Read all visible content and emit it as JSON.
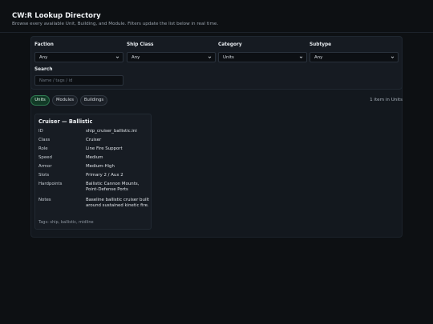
{
  "header": {
    "title": "CW:R Lookup Directory",
    "subtitle": "Browse every available Unit, Building, and Module. Filters update the list below in real time."
  },
  "filters": {
    "faction": {
      "label": "Faction",
      "value": "Any"
    },
    "ship_class": {
      "label": "Ship Class",
      "value": "Any"
    },
    "category": {
      "label": "Category",
      "value": "Units"
    },
    "subtype": {
      "label": "Subtype",
      "value": "Any"
    },
    "search": {
      "label": "Search",
      "placeholder": "Name / tags / id"
    }
  },
  "tabs": [
    {
      "label": "Units",
      "active": true
    },
    {
      "label": "Modules",
      "active": false
    },
    {
      "label": "Buildings",
      "active": false
    }
  ],
  "result_count": "1 item in Units",
  "card": {
    "title": "Cruiser — Ballistic",
    "rows": [
      {
        "key": "ID",
        "value": "ship_cruiser_ballistic.ini"
      },
      {
        "key": "Class",
        "value": "Cruiser"
      },
      {
        "key": "Role",
        "value": "Line Fire Support"
      },
      {
        "key": "Speed",
        "value": "Medium"
      },
      {
        "key": "Armor",
        "value": "Medium-High"
      },
      {
        "key": "Slots",
        "value": "Primary 2 / Aux 2"
      },
      {
        "key": "Hardpoints",
        "value": "Ballistic Cannon Mounts, Point-Defense Ports"
      },
      {
        "key": "Notes",
        "value": "Baseline ballistic cruiser built around sustained kinetic fire."
      }
    ],
    "tags": "Tags: ship, ballistic, midline"
  },
  "colors": {
    "background": "#0d1013",
    "panel": "#13181e",
    "accent_active_tab": "#2f7a51"
  }
}
